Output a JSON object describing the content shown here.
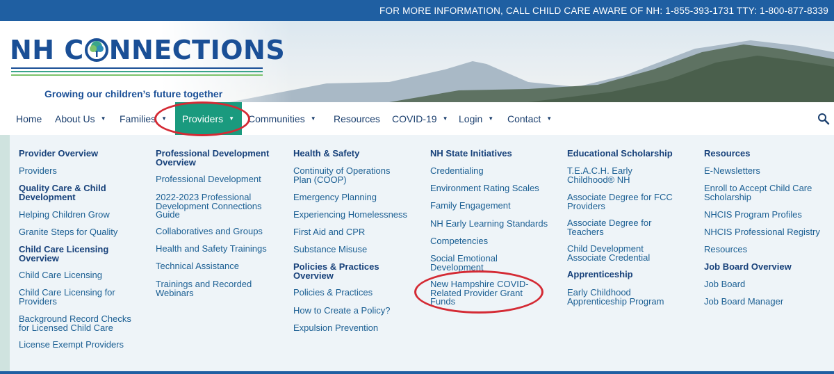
{
  "topbar": {
    "info": "FOR MORE INFORMATION, CALL CHILD CARE AWARE OF NH: 1-855-393-1731   TTY: 1-800-877-8339"
  },
  "logo": {
    "title_left": "NH C",
    "title_right": "NNECTIONS",
    "tagline": "Growing our children’s future together"
  },
  "colors": {
    "brand_blue": "#1a4f96",
    "active_green": "#1a9a7e",
    "link_blue": "#1b5f93",
    "highlight_red": "#d42a34",
    "topbar_blue": "#1f5fa2"
  },
  "nav": {
    "items": [
      {
        "label": "Home",
        "has_dropdown": false
      },
      {
        "label": "About Us",
        "has_dropdown": true
      },
      {
        "label": "Families",
        "has_dropdown": true
      },
      {
        "label": "Providers",
        "has_dropdown": true,
        "active": true
      },
      {
        "label": "Communities",
        "has_dropdown": true
      },
      {
        "label": "Resources",
        "has_dropdown": false
      },
      {
        "label": "COVID-19",
        "has_dropdown": true
      },
      {
        "label": "Login",
        "has_dropdown": true
      },
      {
        "label": "Contact",
        "has_dropdown": true
      }
    ],
    "caret": "▼",
    "search_icon": "search-icon"
  },
  "menu": {
    "col1": [
      {
        "text": "Provider Overview",
        "heading": true
      },
      {
        "text": "Providers"
      },
      {
        "text": "Quality Care & Child Development",
        "heading": true
      },
      {
        "text": "Helping Children Grow"
      },
      {
        "text": "Granite Steps for Quality"
      },
      {
        "text": "Child Care Licensing Overview",
        "heading": true
      },
      {
        "text": "Child Care Licensing"
      },
      {
        "text": "Child Care Licensing for Providers"
      },
      {
        "text": "Background Record Checks for Licensed Child Care"
      },
      {
        "text": "License Exempt Providers"
      }
    ],
    "col2": [
      {
        "text": "Professional Development Overview",
        "heading": true
      },
      {
        "text": "Professional Development"
      },
      {
        "text": "2022-2023 Professional Development Connections Guide"
      },
      {
        "text": "Collaboratives and Groups"
      },
      {
        "text": "Health and Safety Trainings"
      },
      {
        "text": "Technical Assistance"
      },
      {
        "text": "Trainings and Recorded Webinars"
      }
    ],
    "col3": [
      {
        "text": "Health & Safety",
        "heading": true
      },
      {
        "text": "Continuity of Operations Plan (COOP)"
      },
      {
        "text": "Emergency Planning"
      },
      {
        "text": "Experiencing Homelessness"
      },
      {
        "text": "First Aid and CPR"
      },
      {
        "text": "Substance Misuse"
      },
      {
        "text": "Policies & Practices Overview",
        "heading": true
      },
      {
        "text": "Policies & Practices"
      },
      {
        "text": "How to Create a Policy?"
      },
      {
        "text": "Expulsion Prevention"
      }
    ],
    "col4": [
      {
        "text": "NH State Initiatives",
        "heading": true
      },
      {
        "text": "Credentialing"
      },
      {
        "text": "Environment Rating Scales"
      },
      {
        "text": "Family Engagement"
      },
      {
        "text": "NH Early Learning Standards"
      },
      {
        "text": "Competencies"
      },
      {
        "text": "Social Emotional Development"
      },
      {
        "text": "New Hampshire COVID-Related Provider Grant Funds"
      }
    ],
    "col5": [
      {
        "text": "Educational Scholarship",
        "heading": true
      },
      {
        "text": "T.E.A.C.H. Early Childhood® NH"
      },
      {
        "text": "Associate Degree for FCC Providers"
      },
      {
        "text": "Associate Degree for Teachers"
      },
      {
        "text": "Child Development Associate Credential"
      },
      {
        "text": "Apprenticeship",
        "heading": true
      },
      {
        "text": "Early Childhood Apprenticeship Program"
      }
    ],
    "col6": [
      {
        "text": "Resources",
        "heading": true
      },
      {
        "text": "E-Newsletters"
      },
      {
        "text": "Enroll to Accept Child Care Scholarship"
      },
      {
        "text": "NHCIS Program Profiles"
      },
      {
        "text": "NHCIS Professional Registry"
      },
      {
        "text": "Resources"
      },
      {
        "text": "Job Board Overview",
        "heading": true
      },
      {
        "text": "Job Board"
      },
      {
        "text": "Job Board Manager"
      }
    ]
  }
}
